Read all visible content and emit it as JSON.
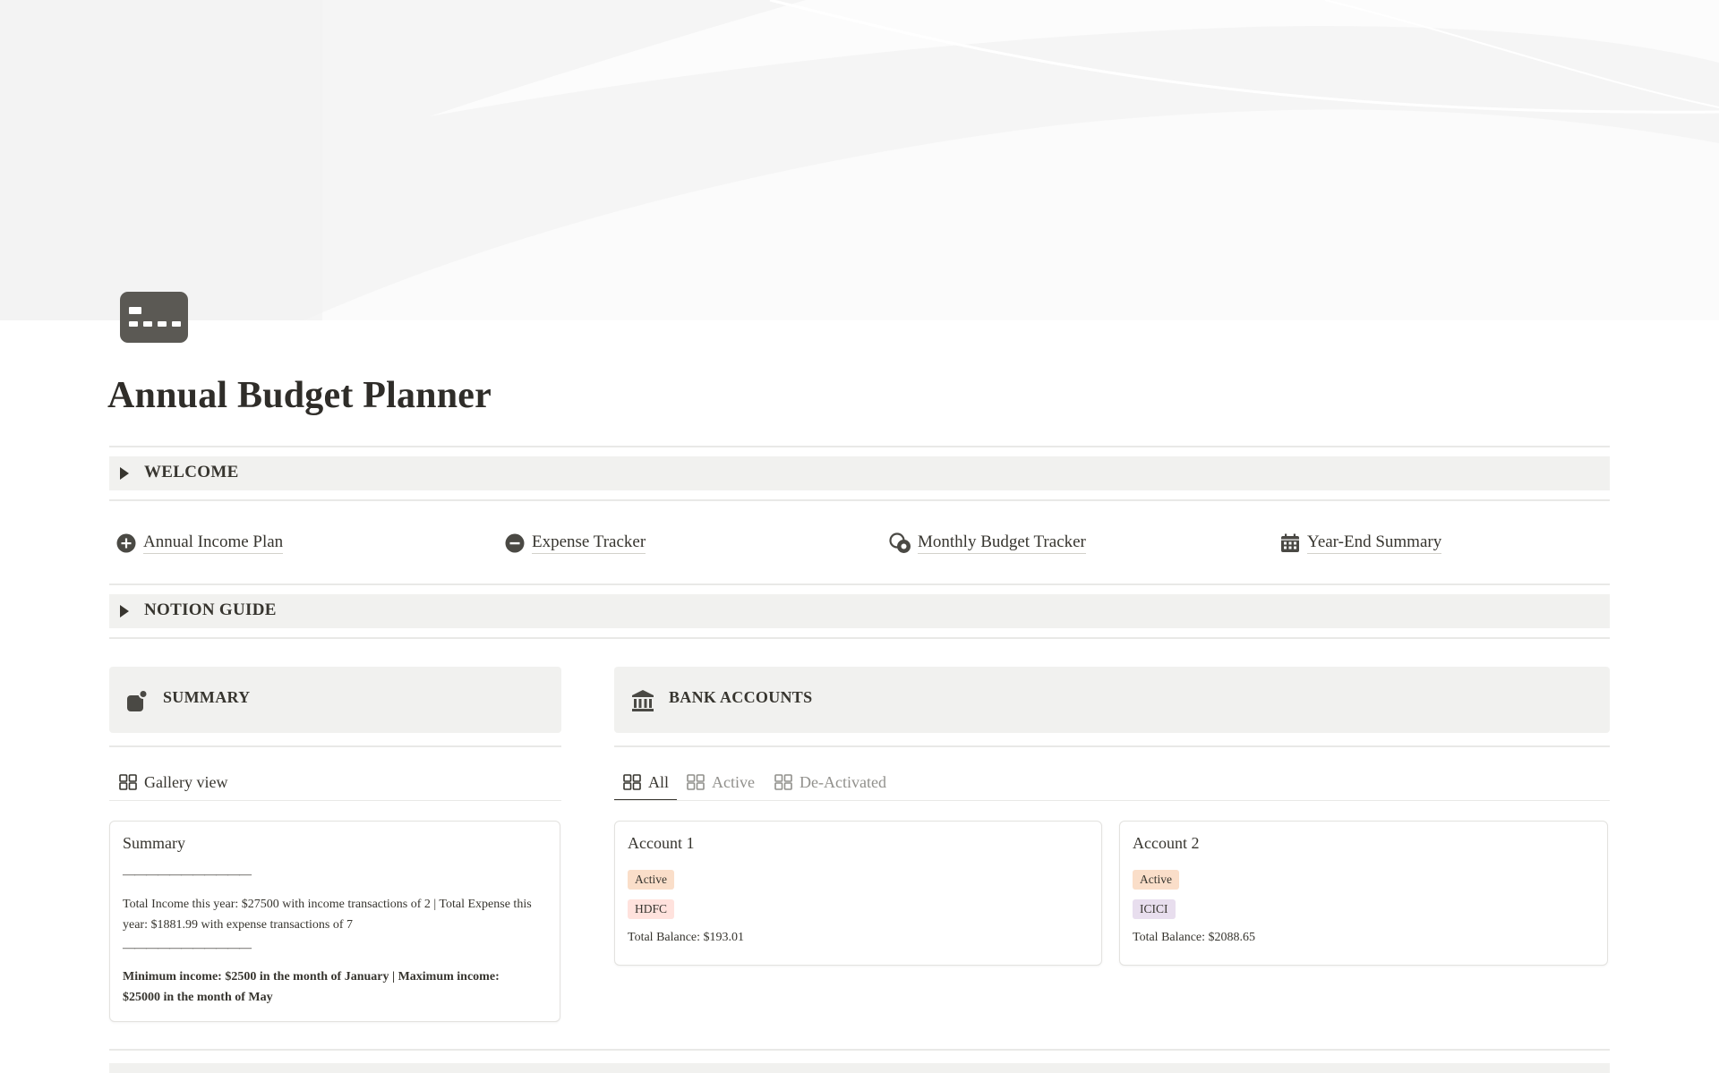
{
  "page": {
    "title": "Annual Budget Planner",
    "icon": "credit-card-icon"
  },
  "toggles": {
    "welcome": "WELCOME",
    "notion_guide": "NOTION GUIDE"
  },
  "links": [
    {
      "label": "Annual Income Plan",
      "icon": "plus-circle-icon"
    },
    {
      "label": "Expense Tracker",
      "icon": "minus-circle-icon"
    },
    {
      "label": "Monthly Budget Tracker",
      "icon": "coins-icon"
    },
    {
      "label": "Year-End Summary",
      "icon": "calendar-icon"
    }
  ],
  "summary": {
    "heading": "SUMMARY",
    "view_label": "Gallery view",
    "card": {
      "title": "Summary",
      "separator_1": "———————————",
      "totals_text": "Total Income this year: $27500 with income transactions of 2 | Total Expense this year: $1881.99 with expense transactions of 7",
      "separator_2": "———————————",
      "minmax_text": "Minimum income: $2500 in the month of January | Maximum income: $25000 in the month of May"
    }
  },
  "bank_accounts": {
    "heading": "BANK ACCOUNTS",
    "tabs": [
      {
        "label": "All",
        "selected": true
      },
      {
        "label": "Active",
        "selected": false
      },
      {
        "label": "De-Activated",
        "selected": false
      }
    ],
    "accounts": [
      {
        "name": "Account 1",
        "status": "Active",
        "bank": "HDFC",
        "balance": "Total Balance: $193.01"
      },
      {
        "name": "Account 2",
        "status": "Active",
        "bank": "ICICI",
        "balance": "Total Balance: $2088.65"
      }
    ]
  },
  "colors": {
    "text": "#37352f",
    "callout_bg": "#f1f1ef",
    "tag_active_bg": "#fadec9",
    "tag_hdfc_bg": "#ffe2dd",
    "tag_icici_bg": "#e8deee"
  }
}
